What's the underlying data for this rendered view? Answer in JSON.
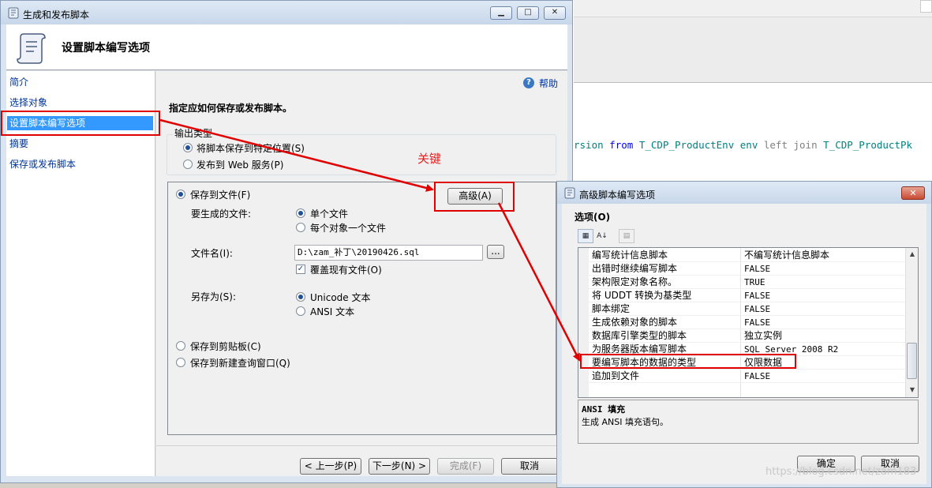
{
  "background_editor": {
    "code_prefix": "rsion",
    "code_kw1": "from",
    "code_t1": "T_CDP_ProductEnv",
    "code_alias": "env",
    "code_join": "left join",
    "code_t2": "T_CDP_ProductPk"
  },
  "wizard": {
    "title": "生成和发布脚本",
    "header_title": "设置脚本编写选项",
    "nav_items": [
      "简介",
      "选择对象",
      "设置脚本编写选项",
      "摘要",
      "保存或发布脚本"
    ],
    "help": "帮助",
    "heading": "指定应如何保存或发布脚本。",
    "output_type": {
      "legend": "输出类型",
      "option_save": "将脚本保存到特定位置(S)",
      "option_publish": "发布到 Web 服务(P)"
    },
    "save_to_file": "保存到文件(F)",
    "advanced_button": "高级(A)",
    "files_to_generate_label": "要生成的文件:",
    "single_file": "单个文件",
    "file_per_object": "每个对象一个文件",
    "file_name_label": "文件名(I):",
    "file_name_value": "D:\\zam_补丁\\20190426.sql",
    "browse_button": "...",
    "overwrite": "覆盖现有文件(O)",
    "save_as_label": "另存为(S):",
    "unicode_text": "Unicode 文本",
    "ansi_text": "ANSI 文本",
    "save_to_clipboard": "保存到剪贴板(C)",
    "save_to_new_query": "保存到新建查询窗口(Q)",
    "buttons": {
      "prev": "< 上一步(P)",
      "next": "下一步(N) >",
      "finish": "完成(F)",
      "cancel": "取消"
    }
  },
  "advanced_dialog": {
    "title": "高级脚本编写选项",
    "section": "选项(O)",
    "properties": [
      {
        "name": "编写统计信息脚本",
        "value": "不编写统计信息脚本"
      },
      {
        "name": "出错时继续编写脚本",
        "value": "FALSE"
      },
      {
        "name": "架构限定对象名称。",
        "value": "TRUE"
      },
      {
        "name": "将 UDDT 转换为基类型",
        "value": "FALSE"
      },
      {
        "name": "脚本绑定",
        "value": "FALSE"
      },
      {
        "name": "生成依赖对象的脚本",
        "value": "FALSE"
      },
      {
        "name": "数据库引擎类型的脚本",
        "value": "独立实例"
      },
      {
        "name": "为服务器版本编写脚本",
        "value": "SQL Server 2008 R2"
      },
      {
        "name": "要编写脚本的数据的类型",
        "value": "仅限数据"
      },
      {
        "name": "追加到文件",
        "value": "FALSE"
      }
    ],
    "description_title": "ANSI 填充",
    "description_text": "生成 ANSI 填充语句。",
    "ok": "确定",
    "cancel": "取消"
  },
  "annotation": "关键",
  "watermark": "https://blog.csdn.net/zam183",
  "colors": {
    "annotation_red": "#e00000",
    "nav_selected": "#3399ff",
    "link_blue": "#003399"
  }
}
